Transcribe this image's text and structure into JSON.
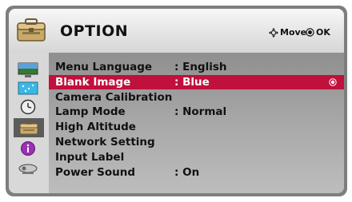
{
  "header": {
    "title": "OPTION",
    "move_hint": "Move",
    "ok_hint": "OK"
  },
  "sidebar": {
    "items": [
      {
        "icon": "monitor-icon"
      },
      {
        "icon": "screen-pattern-icon"
      },
      {
        "icon": "clock-icon"
      },
      {
        "icon": "option-toolbox-icon",
        "selected": true
      },
      {
        "icon": "info-icon"
      },
      {
        "icon": "projector-icon"
      }
    ]
  },
  "menu": {
    "items": [
      {
        "label": "Menu Language",
        "value": ": English"
      },
      {
        "label": "Blank Image",
        "value": ": Blue",
        "selected": true
      },
      {
        "label": "Camera Calibration",
        "value": ""
      },
      {
        "label": "Lamp Mode",
        "value": ": Normal"
      },
      {
        "label": "High Altitude",
        "value": ""
      },
      {
        "label": "Network Setting",
        "value": ""
      },
      {
        "label": "Input Label",
        "value": ""
      },
      {
        "label": "Power Sound",
        "value": ": On"
      }
    ]
  },
  "colors": {
    "selection": "#c0103c",
    "frame": "#7e7e7e"
  }
}
